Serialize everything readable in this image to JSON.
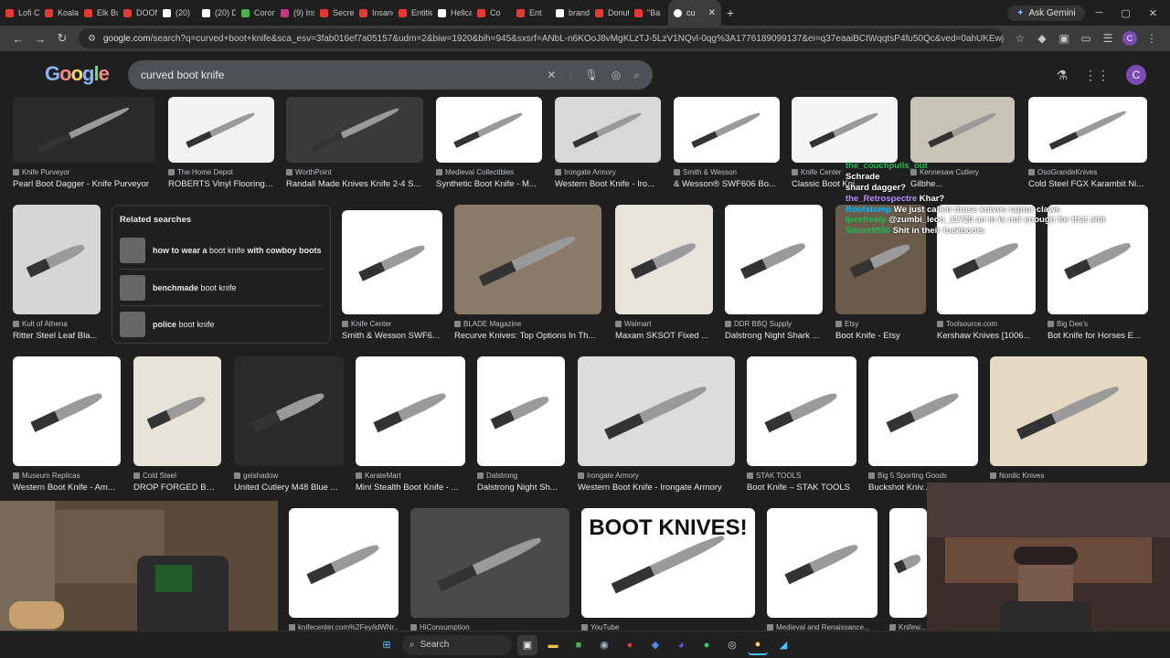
{
  "tabs": [
    {
      "label": "Lofi Ch",
      "color": "#e53935"
    },
    {
      "label": "Koala C",
      "color": "#e53935"
    },
    {
      "label": "Elk Bug",
      "color": "#e53935"
    },
    {
      "label": "DOOM",
      "color": "#e53935"
    },
    {
      "label": "(20)",
      "color": "#ffffff"
    },
    {
      "label": "(20) Do",
      "color": "#ffffff"
    },
    {
      "label": "Corona",
      "color": "#4caf50"
    },
    {
      "label": "(9) Inst",
      "color": "#c13584"
    },
    {
      "label": "Secret",
      "color": "#e53935"
    },
    {
      "label": "Insane",
      "color": "#e53935"
    },
    {
      "label": "Entitlec",
      "color": "#e53935"
    },
    {
      "label": "Hellcat",
      "color": "#ffffff"
    },
    {
      "label": "Co",
      "color": "#e53935"
    },
    {
      "label": "Ent",
      "color": "#e53935"
    },
    {
      "label": "brando",
      "color": "#ffffff"
    },
    {
      "label": "Donut",
      "color": "#e53935"
    },
    {
      "label": "\"Ba",
      "color": "#e53935"
    }
  ],
  "active_tab": {
    "label": "cu"
  },
  "ask_gemini": "Ask Gemini",
  "url": {
    "host": "google.com",
    "path": "/search?q=curved+boot+knife&sca_esv=3fab016ef7a05157&udm=2&biw=1920&bih=945&sxsrf=ANbL-n6KOoJ8vMgKLzTJ-5LzV1NQvl-0qg%3A1776189099137&ei=q37eaaiBCIWqqtsP4fu50Qc&ved=0ahUKEwjogruC9O2T..."
  },
  "google": {
    "logo": "Google",
    "query": "curved boot knife",
    "avatar": "C"
  },
  "row1": [
    {
      "src": "Knife Purveyor",
      "title": "Pearl Boot Dagger - Knife Purveyor",
      "bg": "#2a2a2a"
    },
    {
      "src": "The Home Depot",
      "title": "ROBERTS Vinyl Flooring ...",
      "bg": "#f2f2f2"
    },
    {
      "src": "WorthPoint",
      "title": "Randall Made Knives Knife 2-4 S...",
      "bg": "#3a3a3a"
    },
    {
      "src": "Medieval Collectibles",
      "title": "Synthetic Boot Knife - M...",
      "bg": "#ffffff"
    },
    {
      "src": "Irongate Armory",
      "title": "Western Boot Knife - Iro...",
      "bg": "#d8d8d8"
    },
    {
      "src": "Smith & Wesson",
      "title": "& Wesson® SWF606 Bo...",
      "bg": "#ffffff"
    },
    {
      "src": "Knife Center",
      "title": "Classic Boot Kni...",
      "bg": "#f5f5f5"
    },
    {
      "src": "Kennesaw Cutlery",
      "title": "Gilbhe...",
      "bg": "#c9c3b5"
    },
    {
      "src": "OsoGrandeKnives",
      "title": "Cold Steel FGX Karambit Ni...",
      "bg": "#ffffff"
    }
  ],
  "related": {
    "heading": "Related searches",
    "items": [
      {
        "bold1": "how to wear a",
        "plain": " boot knife ",
        "bold2": "with cowboy boots"
      },
      {
        "bold1": "benchmade",
        "plain": " boot knife",
        "bold2": ""
      },
      {
        "bold1": "police",
        "plain": " boot knife",
        "bold2": ""
      }
    ]
  },
  "row2": [
    {
      "src": "Kult of Athena",
      "title": "Ritter Steel Leaf Bla...",
      "bg": "#d6d6d6"
    },
    {
      "src": "Knife Center",
      "title": "Smith & Wesson SWF6...",
      "bg": "#ffffff"
    },
    {
      "src": "BLADE Magazine",
      "title": "Recurve Knives: Top Options In Th...",
      "bg": "#8a7a6a"
    },
    {
      "src": "Walmart",
      "title": "Maxam SKSOT Fixed ...",
      "bg": "#e8e4dc"
    },
    {
      "src": "DDR BBQ Supply",
      "title": "Dalstrong Night Shark ...",
      "bg": "#ffffff"
    },
    {
      "src": "Etsy",
      "title": "Boot Knife - Etsy",
      "bg": "#6b5b4b"
    },
    {
      "src": "Toolsource.com",
      "title": "Kershaw Knives [1006...",
      "bg": "#ffffff"
    },
    {
      "src": "Big Dee's",
      "title": "Bot Knife for Horses E...",
      "bg": "#ffffff"
    }
  ],
  "row3": [
    {
      "src": "Museum Replicas",
      "title": "Western Boot Knife - Am...",
      "bg": "#ffffff"
    },
    {
      "src": "Cold Steel",
      "title": "DROP FORGED BOO...",
      "bg": "#e8e2d8"
    },
    {
      "src": "geishadow",
      "title": "United Cutlery M48 Blue ...",
      "bg": "#2a2a2a"
    },
    {
      "src": "KarateMart",
      "title": "Mini Stealth Boot Knife - ...",
      "bg": "#ffffff"
    },
    {
      "src": "Dalstrong",
      "title": "Dalstrong Night Sh...",
      "bg": "#ffffff"
    },
    {
      "src": "Irongate Armory",
      "title": "Western Boot Knife - Irongate Armory",
      "bg": "#dcdcdc"
    },
    {
      "src": "STAK TOOLS",
      "title": "Boot Knife – STAK TOOLS",
      "bg": "#ffffff"
    },
    {
      "src": "Big 5 Sporting Goods",
      "title": "Buckshot Kniv...",
      "bg": "#ffffff"
    },
    {
      "src": "Nordic Knives",
      "title": "",
      "bg": "#e6d9c4"
    }
  ],
  "row4": [
    {
      "src": "knifecenter.com%2Fey/idWNr...",
      "bg": "#ffffff"
    },
    {
      "src": "HiConsumption",
      "bg": "#4a4a4a"
    },
    {
      "src": "YouTube",
      "bg": "#ffffff",
      "caption": "BOOT KNIVES!"
    },
    {
      "src": "Medieval and Renaissance...",
      "bg": "#ffffff"
    },
    {
      "src": "Knifew...",
      "bg": "#ffffff"
    }
  ],
  "chat": [
    {
      "user": "the_couchpulls_out",
      "msg": "",
      "color": "#1db954"
    },
    {
      "user": "",
      "msg": "Schrade",
      "color": "#ffffff"
    },
    {
      "user": "",
      "msg": "shard dagger?",
      "color": "#ffffff"
    },
    {
      "user": "the_Retrospectre",
      "msg": "Khar?",
      "color": "#b58cff"
    },
    {
      "user": "Rootstomp",
      "msg": "We just called those knives raptor claws",
      "color": "#00b7ff"
    },
    {
      "user": "ipeefreely",
      "msg": "@zumbi_leon_11720 an in is not enough for that shit",
      "color": "#1db954"
    },
    {
      "user": "Simax9550",
      "msg": "Shit in their fuckboots",
      "color": "#1db954"
    }
  ],
  "taskbar": {
    "search": "Search"
  },
  "colors": {
    "bg": "#1f1f1f",
    "search_bg": "#4d5156",
    "accent": "#8ab4f8"
  }
}
